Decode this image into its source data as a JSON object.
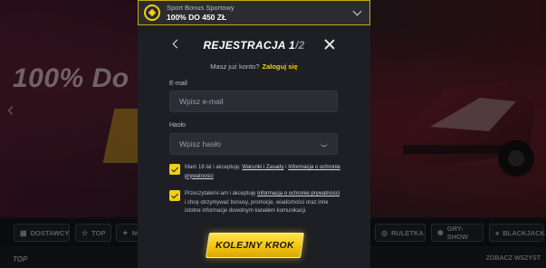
{
  "background": {
    "promo_text": "100% Do",
    "nav_chips": [
      {
        "label": "DOSTAWCY",
        "icon": "grid-icon"
      },
      {
        "label": "TOP",
        "icon": "star-icon"
      },
      {
        "label": "NO",
        "icon": "sparkle-icon"
      },
      {
        "label": "RULETKA",
        "icon": "roulette-icon"
      },
      {
        "label": "GRY-SHOW",
        "icon": "show-icon"
      },
      {
        "label": "BLACKJACK",
        "icon": "cards-icon"
      }
    ],
    "section_title": "TOP",
    "see_all": "ZOBACZ WSZYST"
  },
  "bonus": {
    "subtitle": "Sport Bonus Sportowy",
    "title": "100% DO 450 ZŁ"
  },
  "header": {
    "title_main": "REJESTRACJA 1",
    "title_sep_total": "/2"
  },
  "account": {
    "prompt": "Masz już konto?",
    "login_link": "Zaloguj się"
  },
  "form": {
    "email_label": "E-mail",
    "email_placeholder": "Wpisz e-mail",
    "password_label": "Hasło",
    "password_placeholder": "Wpisz hasło"
  },
  "consents": {
    "age_prefix": "Mam 18 lat i akceptuję:",
    "terms_link": "Warunki i Zasady",
    "and": "i",
    "privacy_link": "Informacja o ochronie prywatności",
    "marketing_prefix": "Przeczytałem/-am i akceptuję",
    "marketing_privacy_link": "Informacja o ochronie prywatności",
    "marketing_rest": "i chcę otrzymywać bonusy, promocje, wiadomości oraz inne istotne informacje dowolnym kanałem komunikacji."
  },
  "next_button": "KOLEJNY KROK",
  "colors": {
    "accent": "#f2cf12",
    "modal_bg": "#1d1f24",
    "input_bg": "#2a2d33"
  }
}
